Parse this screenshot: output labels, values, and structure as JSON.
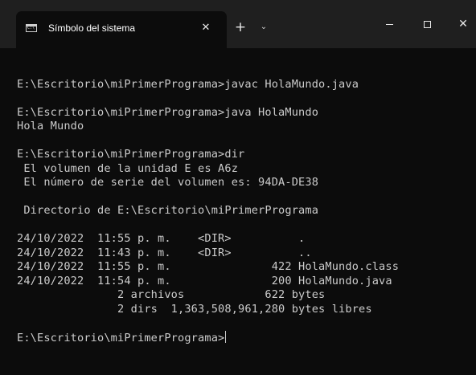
{
  "window": {
    "tab_title": "Símbolo del sistema",
    "tab_icon_text": "C:\\",
    "tab_close_glyph": "✕",
    "new_tab_glyph": "+",
    "dropdown_glyph": "⌄",
    "close_glyph": "✕"
  },
  "terminal": {
    "lines": [
      "",
      "E:\\Escritorio\\miPrimerPrograma>javac HolaMundo.java",
      "",
      "E:\\Escritorio\\miPrimerPrograma>java HolaMundo",
      "Hola Mundo",
      "",
      "E:\\Escritorio\\miPrimerPrograma>dir",
      " El volumen de la unidad E es A6z",
      " El número de serie del volumen es: 94DA-DE38",
      "",
      " Directorio de E:\\Escritorio\\miPrimerPrograma",
      "",
      "24/10/2022  11:55 p. m.    <DIR>          .",
      "24/10/2022  11:43 p. m.    <DIR>          ..",
      "24/10/2022  11:55 p. m.               422 HolaMundo.class",
      "24/10/2022  11:54 p. m.               200 HolaMundo.java",
      "               2 archivos            622 bytes",
      "               2 dirs  1,363,508,961,280 bytes libres",
      "",
      "E:\\Escritorio\\miPrimerPrograma>"
    ]
  },
  "colors": {
    "background": "#0c0c0c",
    "titlebar": "#1f1f1f",
    "text": "#cccccc"
  }
}
